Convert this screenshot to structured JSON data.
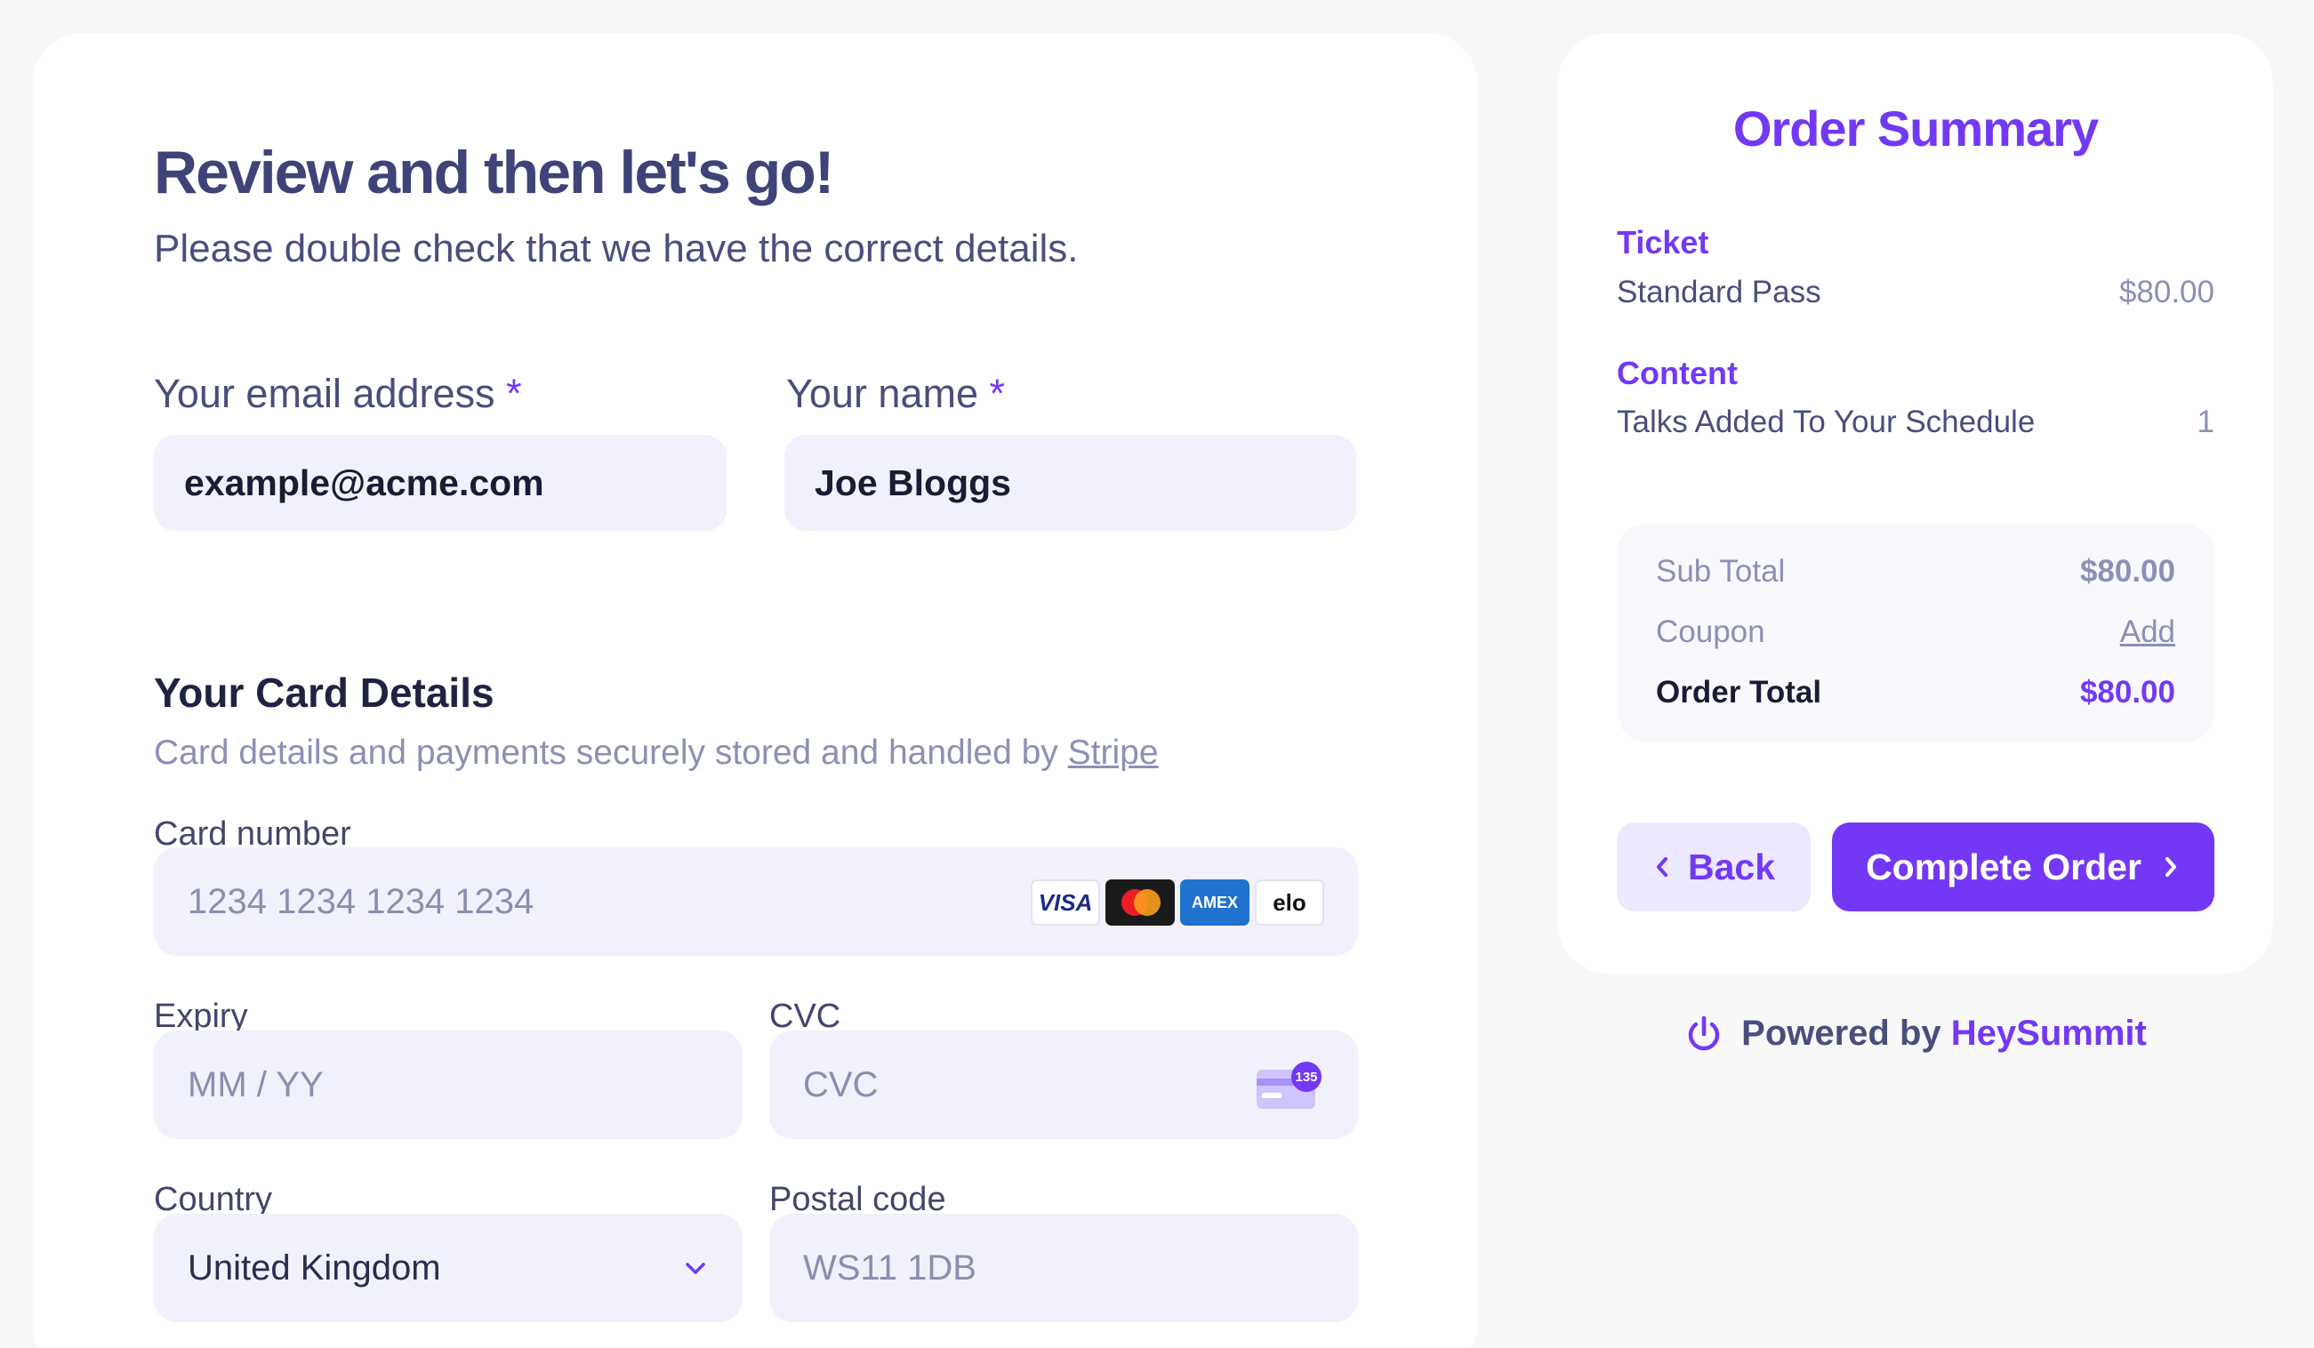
{
  "form": {
    "heading": "Review and then let's go!",
    "subheading": "Please double check that we have the correct details.",
    "email": {
      "label": "Your email address",
      "required_marker": "*",
      "value": "example@acme.com"
    },
    "name": {
      "label": "Your name",
      "required_marker": "*",
      "value": "Joe Bloggs"
    }
  },
  "card": {
    "title": "Your Card Details",
    "subtitle": "Card details and payments securely stored and handled by",
    "stripe_link": "Stripe",
    "number": {
      "label": "Card number",
      "placeholder": "1234 1234 1234 1234"
    },
    "brands": [
      "VISA",
      "mastercard",
      "AMEX",
      "elo"
    ],
    "expiry": {
      "label": "Expiry",
      "placeholder": "MM / YY"
    },
    "cvc": {
      "label": "CVC",
      "placeholder": "CVC",
      "icon_badge": "135"
    },
    "country": {
      "label": "Country",
      "value": "United Kingdom"
    },
    "postal": {
      "label": "Postal code",
      "placeholder": "WS11 1DB"
    }
  },
  "summary": {
    "title": "Order Summary",
    "ticket_heading": "Ticket",
    "ticket_item": "Standard Pass",
    "ticket_price": "$80.00",
    "content_heading": "Content",
    "content_item": "Talks Added To Your Schedule",
    "content_count": "1",
    "subtotal_label": "Sub Total",
    "subtotal_value": "$80.00",
    "coupon_label": "Coupon",
    "coupon_action": "Add",
    "total_label": "Order Total",
    "total_value": "$80.00",
    "back_label": "Back",
    "complete_label": "Complete Order"
  },
  "footer": {
    "powered_prefix": "Powered by",
    "powered_brand": "HeySummit"
  },
  "colors": {
    "accent": "#7338f5",
    "heading": "#3f4377",
    "input_bg": "#f1f1fb"
  }
}
